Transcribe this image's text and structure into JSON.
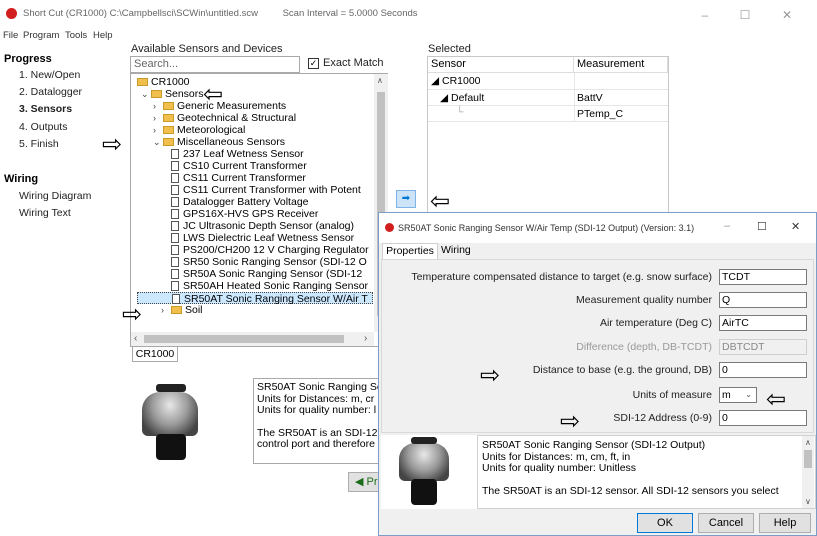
{
  "app": {
    "title": "Short Cut (CR1000) C:\\Campbellsci\\SCWin\\untitled.scw",
    "scan_interval": "Scan Interval = 5.0000 Seconds"
  },
  "window_controls": {
    "minimize": "–",
    "maximize": "☐",
    "close": "✕"
  },
  "menu": [
    "File",
    "Program",
    "Tools",
    "Help"
  ],
  "progress": {
    "heading": "Progress",
    "items": [
      "1. New/Open",
      "2. Datalogger",
      "3. Sensors",
      "4. Outputs",
      "5. Finish"
    ],
    "active_index": 2
  },
  "wiring": {
    "heading": "Wiring",
    "items": [
      "Wiring Diagram",
      "Wiring Text"
    ]
  },
  "sensors_panel": {
    "heading": "Available Sensors and Devices",
    "search_placeholder": "Search...",
    "exact_match_label": "Exact Match",
    "exact_match_checked": true,
    "tree": [
      {
        "label": "CR1000",
        "icon": "folder-icon"
      },
      {
        "label": "Sensors",
        "icon": "folder-icon",
        "expand": "⌄"
      },
      {
        "label": "Generic Measurements",
        "icon": "folder-icon",
        "expand": "›"
      },
      {
        "label": "Geotechnical & Structural",
        "icon": "folder-icon",
        "expand": "›"
      },
      {
        "label": "Meteorological",
        "icon": "folder-icon",
        "expand": "›"
      },
      {
        "label": "Miscellaneous Sensors",
        "icon": "folder-icon",
        "expand": "⌄"
      },
      {
        "label": "237 Leaf Wetness Sensor",
        "icon": "document-icon"
      },
      {
        "label": "CS10 Current Transformer",
        "icon": "document-icon"
      },
      {
        "label": "CS11 Current Transformer",
        "icon": "document-icon"
      },
      {
        "label": "CS11 Current Transformer with Potent",
        "icon": "document-icon"
      },
      {
        "label": "Datalogger Battery Voltage",
        "icon": "document-icon"
      },
      {
        "label": "GPS16X-HVS GPS Receiver",
        "icon": "document-icon"
      },
      {
        "label": "JC Ultrasonic Depth Sensor (analog)",
        "icon": "document-icon"
      },
      {
        "label": "LWS Dielectric Leaf Wetness Sensor",
        "icon": "document-icon"
      },
      {
        "label": "PS200/CH200 12 V Charging Regulator",
        "icon": "document-icon"
      },
      {
        "label": "SR50 Sonic Ranging Sensor (SDI-12 O",
        "icon": "document-icon"
      },
      {
        "label": "SR50A Sonic Ranging Sensor (SDI-12",
        "icon": "document-icon"
      },
      {
        "label": "SR50AH Heated Sonic Ranging Sensor",
        "icon": "document-icon"
      },
      {
        "label": "SR50AT Sonic Ranging Sensor W/Air T",
        "icon": "document-icon",
        "selected": true
      },
      {
        "label": "Soil",
        "icon": "folder-icon",
        "expand": "›"
      }
    ],
    "tab": "CR1000",
    "description": [
      "SR50AT Sonic Ranging Se",
      "Units for Distances: m, cr",
      "Units for quality number: l",
      "",
      "The SR50AT is an SDI-12",
      "control port and therefore"
    ],
    "prev_button": "◀ Pr"
  },
  "selected_panel": {
    "heading": "Selected",
    "columns": [
      "Sensor",
      "Measurement"
    ],
    "rows": [
      {
        "sensor": "CR1000",
        "measurement": ""
      },
      {
        "sensor": "Default",
        "measurement": "BattV"
      },
      {
        "sensor": "",
        "measurement": "PTemp_C"
      }
    ],
    "add_button": "➡"
  },
  "dialog": {
    "title": "SR50AT Sonic Ranging Sensor W/Air Temp (SDI-12 Output) (Version: 3.1)",
    "tabs": [
      "Properties",
      "Wiring"
    ],
    "active_tab": "Properties",
    "fields": [
      {
        "label": "Temperature compensated distance to target (e.g. snow surface)",
        "value": "TCDT",
        "disabled": false
      },
      {
        "label": "Measurement quality number",
        "value": "Q",
        "disabled": false
      },
      {
        "label": "Air temperature (Deg C)",
        "value": "AirTC",
        "disabled": false
      },
      {
        "label": "Difference (depth, DB-TCDT)",
        "value": "DBTCDT",
        "disabled": true
      },
      {
        "label": "Distance to base (e.g. the ground, DB)",
        "value": "0",
        "disabled": false
      },
      {
        "label": "Units of measure",
        "value": "m",
        "disabled": false,
        "dropdown": true
      },
      {
        "label": "SDI-12 Address (0-9)",
        "value": "0",
        "disabled": false
      }
    ],
    "description": [
      "SR50AT Sonic Ranging Sensor (SDI-12 Output)",
      "Units for Distances: m, cm, ft, in",
      "Units for quality number: Unitless",
      "",
      "The SR50AT is an SDI-12 sensor. All SDI-12 sensors you select"
    ],
    "buttons": {
      "ok": "OK",
      "cancel": "Cancel",
      "help": "Help"
    }
  },
  "colors": {
    "accent": "#0078d7",
    "close_icon": "#d11f1f",
    "selection": "#cce8ff"
  }
}
